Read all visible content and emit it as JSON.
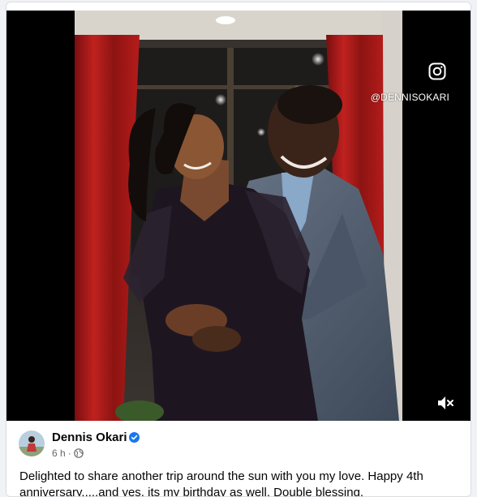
{
  "post": {
    "author": "Dennis Okari",
    "time": "6 h",
    "separator": "·",
    "text": "Delighted to share another trip around the sun with you my love. Happy 4th anniversary.....and yes, its my birthday as well. Double blessing."
  },
  "media": {
    "watermark": "@DENNISOKARI"
  },
  "icons": {
    "instagram": "instagram-icon",
    "mute": "volume-mute-icon",
    "verified": "verified-badge-icon",
    "audience": "globe-icon"
  },
  "colors": {
    "verified": "#1877f2",
    "secondary_text": "#65676b",
    "primary_text": "#050505"
  }
}
